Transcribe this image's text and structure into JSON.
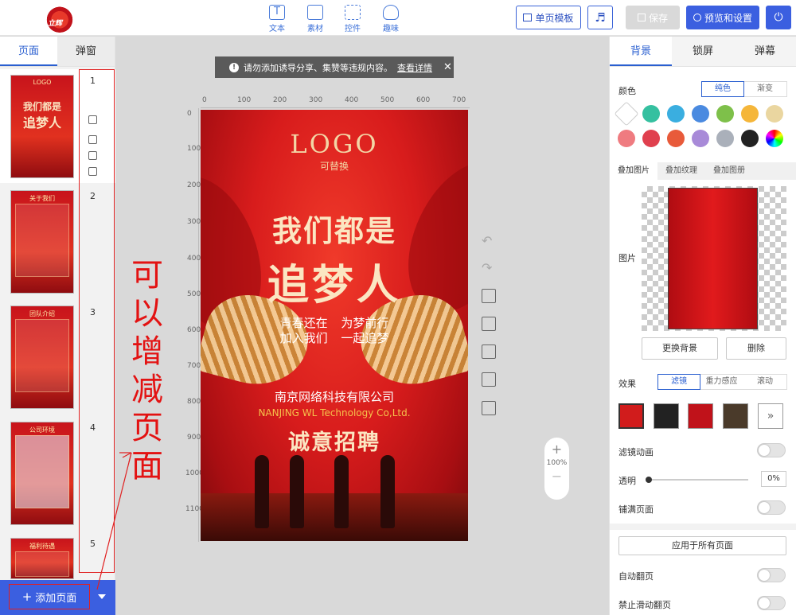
{
  "header": {
    "logo_text": "立辉",
    "tools": [
      {
        "label": "文本",
        "icon": "text-icon"
      },
      {
        "label": "素材",
        "icon": "image-icon"
      },
      {
        "label": "控件",
        "icon": "widget-icon"
      },
      {
        "label": "趣味",
        "icon": "bulb-icon"
      }
    ],
    "template_btn": "单页模板",
    "music_icon": "music-icon",
    "save_btn": "保存",
    "preview_btn": "预览和设置",
    "power_icon": "power-icon"
  },
  "left": {
    "tabs": [
      "页面",
      "弹窗"
    ],
    "pages": [
      {
        "num": "1",
        "title": "LOGO"
      },
      {
        "num": "2",
        "title": "关于我们"
      },
      {
        "num": "3",
        "title": "团队介绍"
      },
      {
        "num": "4",
        "title": "公司环境"
      },
      {
        "num": "5",
        "title": "福利待遇"
      }
    ],
    "add_page": "添加页面"
  },
  "annotation": [
    "可",
    "以",
    "增",
    "减",
    "页",
    "面"
  ],
  "notice": {
    "text": "请勿添加诱导分享、集赞等违规内容。",
    "link": "查看详情"
  },
  "ruler": {
    "h": [
      "0",
      "100",
      "200",
      "300",
      "400",
      "500",
      "600",
      "700"
    ],
    "v": [
      "0",
      "100",
      "200",
      "300",
      "400",
      "500",
      "600",
      "700",
      "800",
      "900",
      "1000",
      "1100"
    ]
  },
  "poster": {
    "logo": "LOGO",
    "logo_sub": "可替换",
    "title1": "我们都是",
    "title2": "追梦人",
    "line1": "青春还在 为梦前行",
    "line2": "加入我们 一起追梦",
    "company": "南京网络科技有限公司",
    "company_en": "NANJING WL Technology Co,Ltd.",
    "hiring": "诚意招聘"
  },
  "zoom": {
    "value": "100%",
    "plus": "+",
    "minus": "−"
  },
  "right": {
    "tabs": [
      "背景",
      "锁屏",
      "弹幕"
    ],
    "color_label": "颜色",
    "color_modes": [
      "纯色",
      "渐变"
    ],
    "swatches": [
      "#ffffff",
      "#35c0a0",
      "#3aaee0",
      "#4a8ae0",
      "#7ec04a",
      "#f5b63a",
      "#ead6a0",
      "#ef7b80",
      "#e0404e",
      "#e85a3a",
      "#a88ad8",
      "#aab0ba",
      "#222222",
      "rainbow"
    ],
    "overlay_tabs": [
      "叠加图片",
      "叠加纹理",
      "叠加图册"
    ],
    "image_label": "图片",
    "change_bg": "更换背景",
    "delete": "删除",
    "effect_label": "效果",
    "effect_modes": [
      "滤镜",
      "重力感应",
      "滚动"
    ],
    "more_icon": "»",
    "filter_anim": "滤镜动画",
    "opacity_label": "透明",
    "opacity_value": "0%",
    "fill_page": "铺满页面",
    "apply_all": "应用于所有页面",
    "auto_flip": "自动翻页",
    "no_swipe": "禁止滑动翻页"
  }
}
